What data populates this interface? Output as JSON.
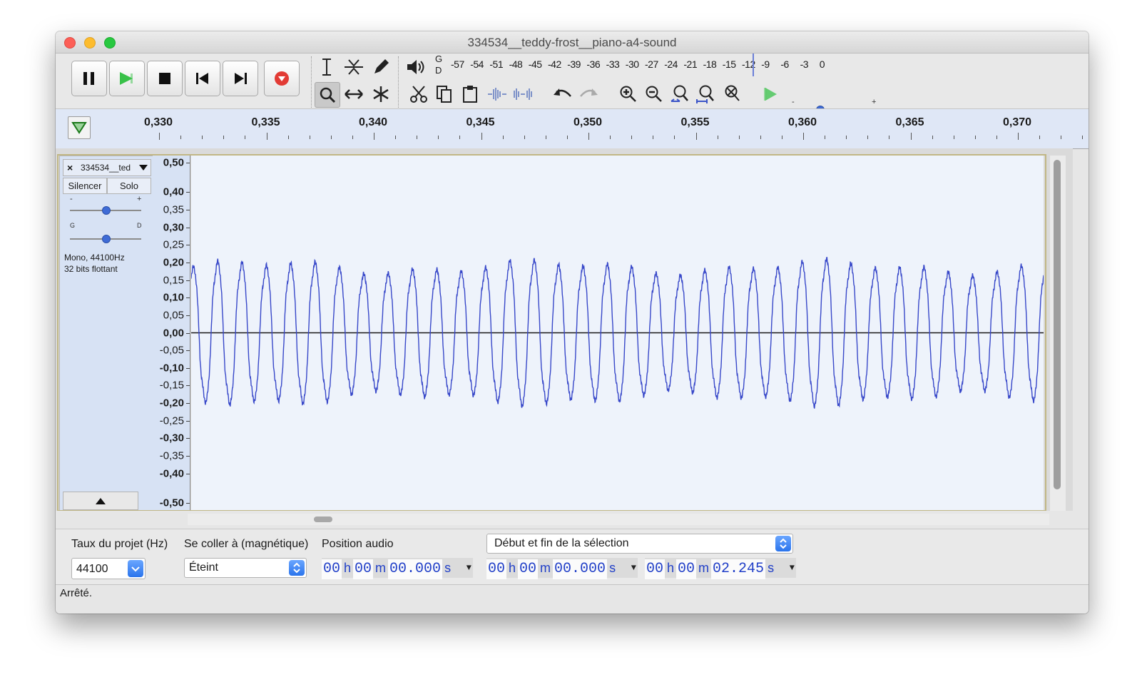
{
  "window": {
    "title": "334534__teddy-frost__piano-a4-sound"
  },
  "transport": {
    "pause": "pause-icon",
    "play": "play-icon",
    "stop": "stop-icon",
    "skip_start": "skip-to-start-icon",
    "skip_end": "skip-to-end-icon",
    "record": "record-icon",
    "play_color": "#39c149",
    "record_color": "#e23b35"
  },
  "meter": {
    "left_channel": "G",
    "right_channel": "D",
    "ticks": [
      "-57",
      "-54",
      "-51",
      "-48",
      "-45",
      "-42",
      "-39",
      "-36",
      "-33",
      "-30",
      "-27",
      "-24",
      "-21",
      "-18",
      "-15",
      "-12",
      "-9",
      "-6",
      "-3",
      "0"
    ]
  },
  "speed": {
    "minus": "-",
    "plus": "+"
  },
  "ruler": {
    "labels": [
      "0,330",
      "0,335",
      "0,340",
      "0,345",
      "0,350",
      "0,355",
      "0,360",
      "0,365",
      "0,370"
    ],
    "background": "#dfe7f6"
  },
  "track": {
    "name": "334534__ted",
    "mute_label": "Silencer",
    "solo_label": "Solo",
    "gain_minus": "-",
    "gain_plus": "+",
    "pan_left": "G",
    "pan_right": "D",
    "info_line1": "Mono, 44100Hz",
    "info_line2": "32 bits flottant",
    "amplitude_labels": [
      "0,50",
      "0,40",
      "0,35",
      "0,30",
      "0,25",
      "0,20",
      "0,15",
      "0,10",
      "0,05",
      "0,00",
      "-0,05",
      "-0,10",
      "-0,15",
      "-0,20",
      "-0,25",
      "-0,30",
      "-0,35",
      "-0,40",
      "-0,50"
    ],
    "amplitude_values": [
      0.5,
      0.4,
      0.35,
      0.3,
      0.25,
      0.2,
      0.15,
      0.1,
      0.05,
      0,
      -0.05,
      -0.1,
      -0.15,
      -0.2,
      -0.25,
      -0.3,
      -0.35,
      -0.4,
      -0.5
    ],
    "waveform_color": "#3848c9",
    "cycles": 35,
    "amplitude": 0.2
  },
  "bottombar": {
    "rate_label": "Taux du projet (Hz)",
    "rate_value": "44100",
    "snap_label": "Se coller à (magnétique)",
    "snap_value": "Éteint",
    "position_label": "Position audio",
    "selection_mode": "Début et fin de la sélection",
    "position_time": {
      "h": "00",
      "m": "00",
      "s": "00.000"
    },
    "sel_start_time": {
      "h": "00",
      "m": "00",
      "s": "00.000"
    },
    "sel_end_time": {
      "h": "00",
      "m": "00",
      "s": "02.245"
    },
    "units": {
      "h": "h",
      "m": "m",
      "s": "s"
    }
  },
  "status": {
    "text": "Arrêté."
  }
}
